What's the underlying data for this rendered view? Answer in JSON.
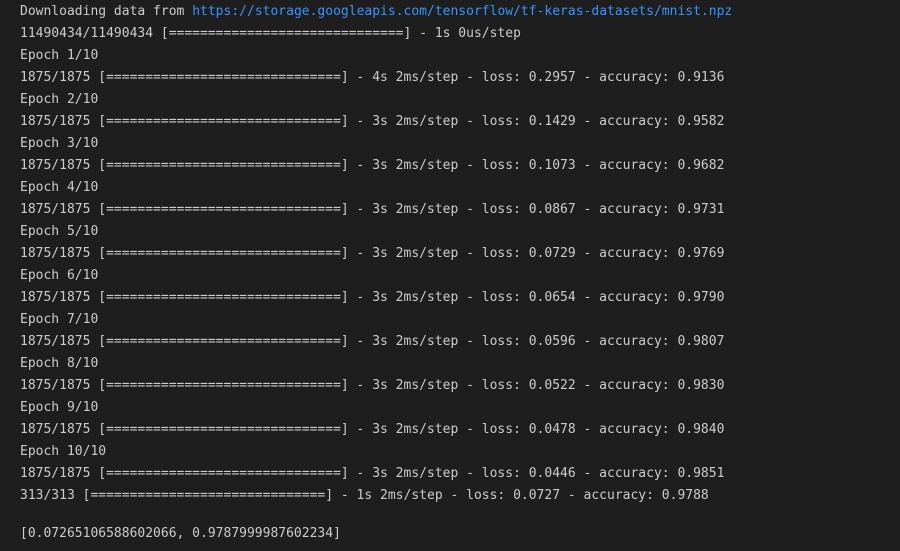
{
  "download": {
    "prefix": "Downloading data from",
    "url": "https://storage.googleapis.com/tensorflow/tf-keras-datasets/mnist.npz",
    "progress_line": "11490434/11490434 [==============================] - 1s 0us/step"
  },
  "epochs": [
    {
      "label": "Epoch 1/10",
      "progress": "1875/1875 [==============================] - 4s 2ms/step - loss: 0.2957 - accuracy: 0.9136"
    },
    {
      "label": "Epoch 2/10",
      "progress": "1875/1875 [==============================] - 3s 2ms/step - loss: 0.1429 - accuracy: 0.9582"
    },
    {
      "label": "Epoch 3/10",
      "progress": "1875/1875 [==============================] - 3s 2ms/step - loss: 0.1073 - accuracy: 0.9682"
    },
    {
      "label": "Epoch 4/10",
      "progress": "1875/1875 [==============================] - 3s 2ms/step - loss: 0.0867 - accuracy: 0.9731"
    },
    {
      "label": "Epoch 5/10",
      "progress": "1875/1875 [==============================] - 3s 2ms/step - loss: 0.0729 - accuracy: 0.9769"
    },
    {
      "label": "Epoch 6/10",
      "progress": "1875/1875 [==============================] - 3s 2ms/step - loss: 0.0654 - accuracy: 0.9790"
    },
    {
      "label": "Epoch 7/10",
      "progress": "1875/1875 [==============================] - 3s 2ms/step - loss: 0.0596 - accuracy: 0.9807"
    },
    {
      "label": "Epoch 8/10",
      "progress": "1875/1875 [==============================] - 3s 2ms/step - loss: 0.0522 - accuracy: 0.9830"
    },
    {
      "label": "Epoch 9/10",
      "progress": "1875/1875 [==============================] - 3s 2ms/step - loss: 0.0478 - accuracy: 0.9840"
    },
    {
      "label": "Epoch 10/10",
      "progress": "1875/1875 [==============================] - 3s 2ms/step - loss: 0.0446 - accuracy: 0.9851"
    }
  ],
  "evaluation_line": "313/313 [==============================] - 1s 2ms/step - loss: 0.0727 - accuracy: 0.9788",
  "result_line": "[0.07265106588602066, 0.9787999987602234]",
  "colors": {
    "background": "#1e1e1e",
    "text": "#cccccc",
    "link": "#3794ff"
  }
}
